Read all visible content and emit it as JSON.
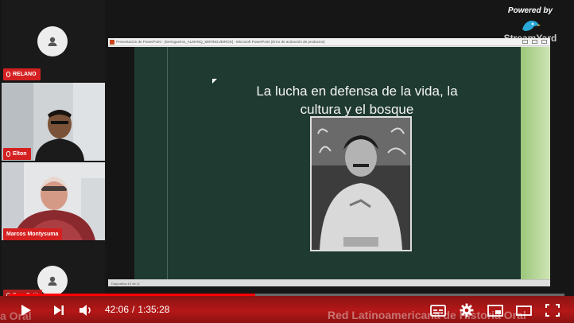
{
  "participants": [
    {
      "name": "RELANO",
      "type": "avatar"
    },
    {
      "name": "Elton",
      "type": "camera"
    },
    {
      "name": "Marcos Montysuma",
      "type": "camera"
    },
    {
      "name": "Pere Petit",
      "type": "avatar"
    }
  ],
  "brand": {
    "powered_by": "Powered by",
    "name": "StreamYard",
    "logo_icon": "streamyard-bird-logo"
  },
  "ppt": {
    "title_bar": "Presentación de PowerPoint - [Seringueiros_ALMANQ_SERINGUEIROS] - Microsoft PowerPoint (Error de activación de productos)",
    "status_bar": "Diapositiva 10 de 11",
    "slide_title": "La lucha en defensa de la vida, la cultura y el bosque",
    "photo_icon": "portrait-photo"
  },
  "player": {
    "current_time": "42:06",
    "separator": "/",
    "duration": "1:35:28",
    "progress_fraction": 0.443,
    "play_icon": "play-icon",
    "next_icon": "next-icon",
    "volume_icon": "volume-icon",
    "subtitles_icon": "subtitles-icon",
    "settings_icon": "gear-icon",
    "miniplayer_icon": "miniplayer-icon",
    "theater_icon": "theater-mode-icon",
    "fullscreen_icon": "fullscreen-icon"
  },
  "banner": {
    "left_text": "a Oral",
    "right_text": "Red Latinoamericana de Historia Oral"
  },
  "colors": {
    "accent_red": "#d42020",
    "progress": "#ff0000",
    "slide_bg": "#1f3a30"
  }
}
